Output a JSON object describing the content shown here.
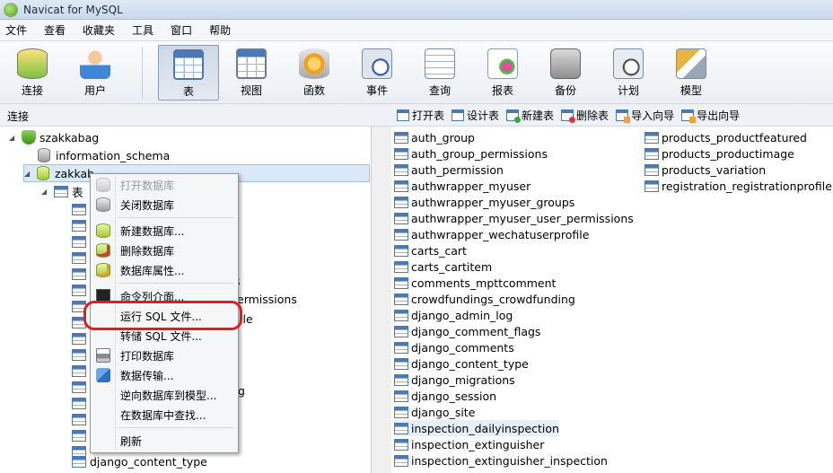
{
  "window": {
    "title": "Navicat for MySQL"
  },
  "menubar": [
    "文件",
    "查看",
    "收藏夹",
    "工具",
    "窗口",
    "帮助"
  ],
  "toolbar": [
    {
      "label": "连接",
      "icon": "connection-icon"
    },
    {
      "label": "用户",
      "icon": "user-icon"
    },
    {
      "label": "表",
      "icon": "table-icon",
      "active": true
    },
    {
      "label": "视图",
      "icon": "view-icon"
    },
    {
      "label": "函数",
      "icon": "function-icon"
    },
    {
      "label": "事件",
      "icon": "event-icon"
    },
    {
      "label": "查询",
      "icon": "query-icon"
    },
    {
      "label": "报表",
      "icon": "report-icon"
    },
    {
      "label": "备份",
      "icon": "backup-icon"
    },
    {
      "label": "计划",
      "icon": "schedule-icon"
    },
    {
      "label": "模型",
      "icon": "model-icon"
    }
  ],
  "subbar": {
    "connection_label": "连接",
    "actions": [
      "打开表",
      "设计表",
      "新建表",
      "删除表",
      "导入向导",
      "导出向导"
    ]
  },
  "tree": {
    "connection": "szakkabag",
    "databases": [
      "information_schema",
      "zakkab"
    ],
    "tables_node": "表",
    "visible_fragments": [
      "s",
      "ermissions",
      "ile",
      "g"
    ],
    "last_visible_table": "django_content_type"
  },
  "tables_list": {
    "column1": [
      "auth_group",
      "auth_group_permissions",
      "auth_permission",
      "authwrapper_myuser",
      "authwrapper_myuser_groups",
      "authwrapper_myuser_user_permissions",
      "authwrapper_wechatuserprofile",
      "carts_cart",
      "carts_cartitem",
      "comments_mpttcomment",
      "crowdfundings_crowdfunding",
      "django_admin_log",
      "django_comment_flags",
      "django_comments",
      "django_content_type",
      "django_migrations",
      "django_session",
      "django_site",
      "inspection_dailyinspection",
      "inspection_extinguisher",
      "inspection_extinguisher_inspection"
    ],
    "column2": [
      "products_productfeatured",
      "products_productimage",
      "products_variation",
      "registration_registrationprofile"
    ]
  },
  "context_menu": [
    {
      "label": "打开数据库",
      "icon": "open-database-icon",
      "disabled": true
    },
    {
      "label": "关闭数据库",
      "icon": "close-database-icon"
    },
    {
      "label": "新建数据库...",
      "icon": "new-database-icon"
    },
    {
      "label": "删除数据库",
      "icon": "delete-database-icon"
    },
    {
      "label": "数据库属性...",
      "icon": "database-properties-icon"
    },
    {
      "label": "命令列介面...",
      "icon": "console-icon"
    },
    {
      "label": "运行 SQL 文件...",
      "icon": "none",
      "highlighted": true
    },
    {
      "label": "转储 SQL 文件...",
      "icon": "none"
    },
    {
      "label": "打印数据库",
      "icon": "print-icon"
    },
    {
      "label": "数据传输...",
      "icon": "data-transfer-icon"
    },
    {
      "label": "逆向数据库到模型...",
      "icon": "none"
    },
    {
      "label": "在数据库中查找...",
      "icon": "none"
    },
    {
      "label": "刷新",
      "icon": "none"
    }
  ],
  "colors": {
    "annotation_ring": "#e01e1e",
    "selection": "#dbe8f8",
    "accent": "#4a79b5"
  }
}
